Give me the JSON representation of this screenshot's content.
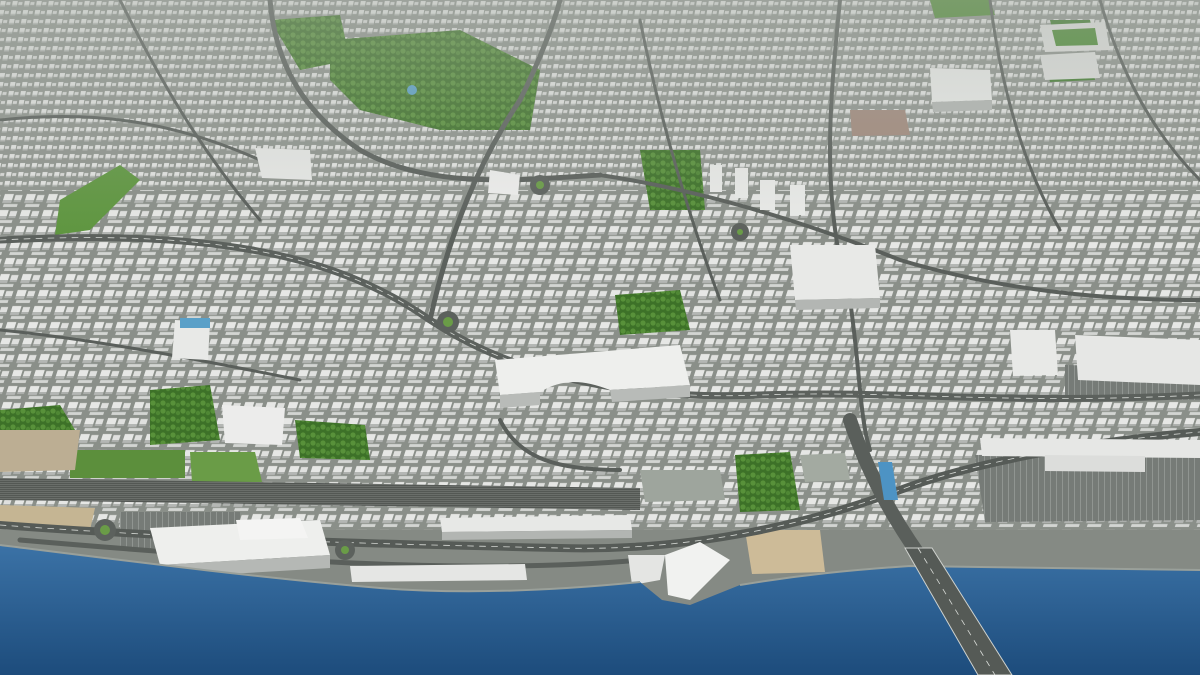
{
  "scene": {
    "subject": "city-model-render",
    "palette": {
      "water_deep": "#1f4f7f",
      "water_light": "#3f78ab",
      "ground": "#7d837c",
      "road": "#5b605c",
      "road_marking": "#d9dcd8",
      "building_roof": "#e9eae8",
      "building_side": "#b9bcba",
      "park": "#3f7a2c",
      "park_light": "#6a9a46",
      "sand": "#c8b79a",
      "plaza": "#9aa39a"
    }
  }
}
